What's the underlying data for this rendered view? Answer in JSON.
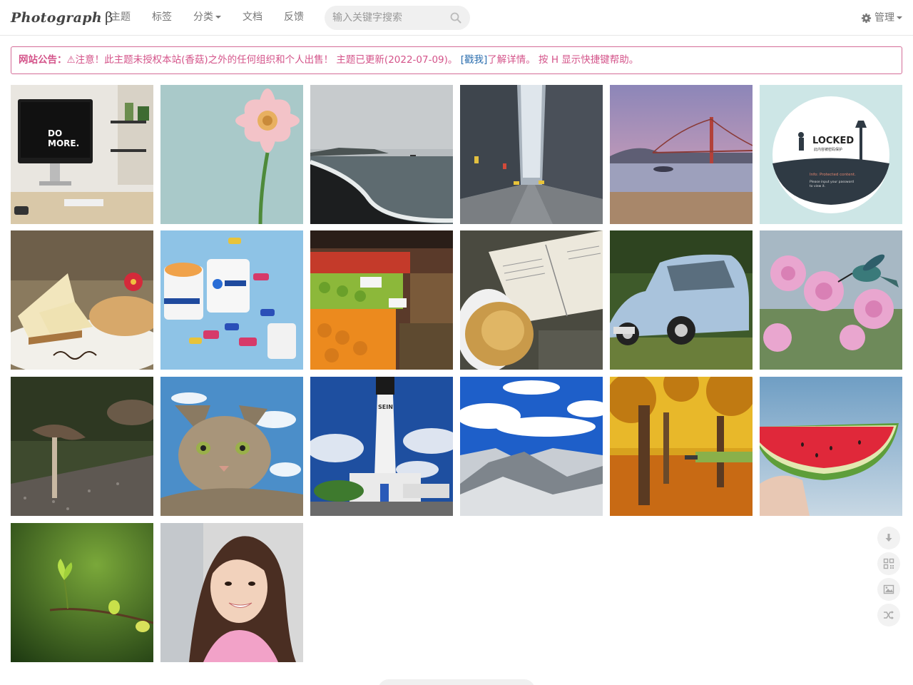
{
  "brand": {
    "name": "Photograph",
    "suffix": "β"
  },
  "nav": {
    "items": [
      {
        "label": "主题"
      },
      {
        "label": "标签"
      },
      {
        "label": "分类"
      },
      {
        "label": "文档"
      },
      {
        "label": "反馈"
      }
    ]
  },
  "search": {
    "placeholder": "输入关键字搜索",
    "value": ""
  },
  "admin": {
    "label": "管理"
  },
  "notice": {
    "prefix": "网站公告：",
    "text": "⚠注意！此主题未授权本站(香菇)之外的任何组织和个人出售！ 主题已更新(2022-07-09)。 ",
    "link": "[戳我]",
    "suffix": "了解详情。 按 H 显示快捷键帮助。"
  },
  "locked": {
    "title": "LOCKED",
    "subtitle": "此内容被密码保护",
    "info": "Info: Protected content.",
    "hint1": "Please input your password",
    "hint2": "to view it."
  },
  "tiles": [
    {
      "name": "desk-workspace"
    },
    {
      "name": "pink-gerbera"
    },
    {
      "name": "black-sand-beach"
    },
    {
      "name": "city-street"
    },
    {
      "name": "golden-gate-bridge"
    },
    {
      "name": "locked-post"
    },
    {
      "name": "cheesecake"
    },
    {
      "name": "igashop-mugs"
    },
    {
      "name": "fruit-market"
    },
    {
      "name": "open-book-bread"
    },
    {
      "name": "vintage-car"
    },
    {
      "name": "hummingbird-flowers"
    },
    {
      "name": "mushroom"
    },
    {
      "name": "cat"
    },
    {
      "name": "lighthouse"
    },
    {
      "name": "snowy-mountains"
    },
    {
      "name": "autumn-park"
    },
    {
      "name": "watermelon"
    },
    {
      "name": "green-sprout"
    },
    {
      "name": "smiling-girl"
    }
  ],
  "tools": [
    "download-icon",
    "qrcode-icon",
    "image-icon",
    "shuffle-icon"
  ],
  "colors": {
    "accent": "#d4548a",
    "link": "#2a6dae"
  }
}
